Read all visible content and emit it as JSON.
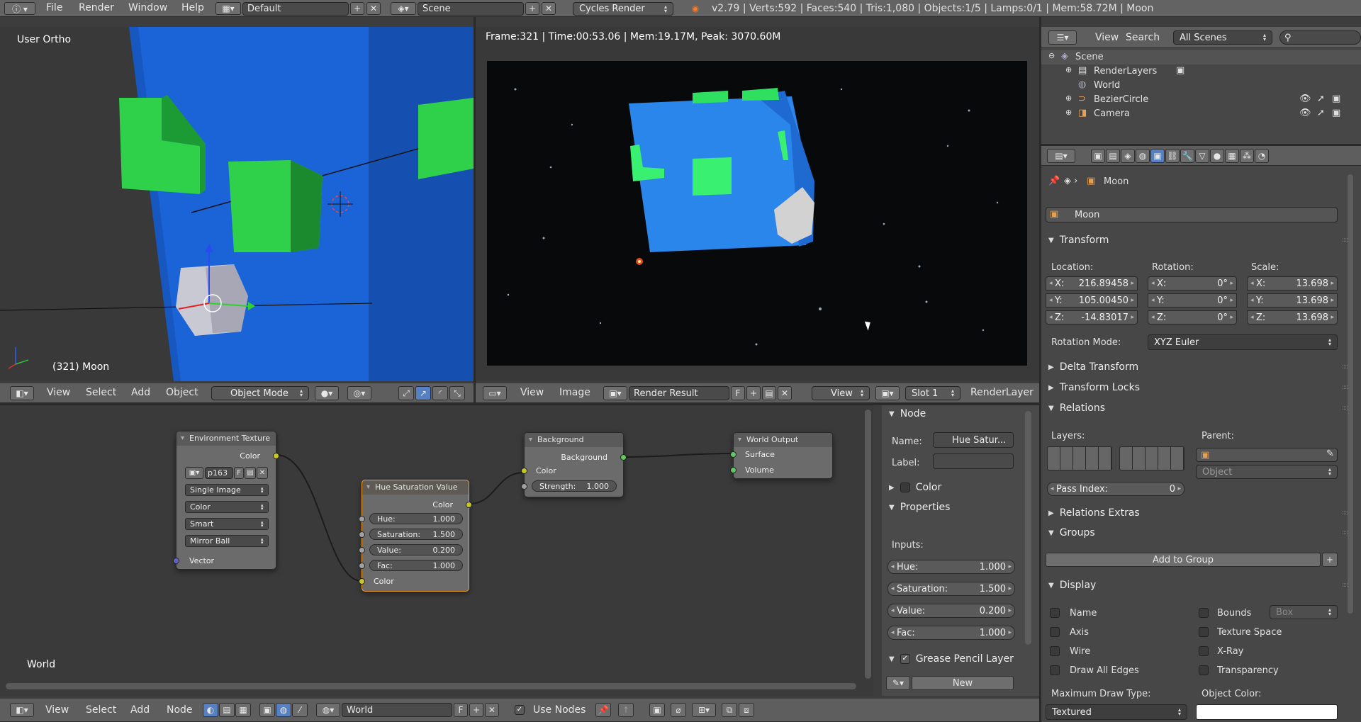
{
  "topbar": {
    "menus": [
      "File",
      "Render",
      "Window",
      "Help"
    ],
    "layout": "Default",
    "scene": "Scene",
    "engine": "Cycles Render",
    "stats": "v2.79 | Verts:592 | Faces:540 | Tris:1,080 | Objects:1/5 | Lamps:0/1 | Mem:58.72M | Moon"
  },
  "viewport3d": {
    "view_label": "User Ortho",
    "object_label": "(321) Moon",
    "menus": [
      "View",
      "Select",
      "Add",
      "Object"
    ],
    "mode": "Object Mode"
  },
  "image_editor": {
    "render_info": "Frame:321 | Time:00:53.06 | Mem:19.17M, Peak: 3070.60M",
    "menus": [
      "View",
      "Image"
    ],
    "image_name": "Render Result",
    "image_flag": "F",
    "view": "View",
    "slot": "Slot 1",
    "layer": "RenderLayer"
  },
  "node_editor": {
    "world_label": "World",
    "menus": [
      "View",
      "Select",
      "Add",
      "Node"
    ],
    "world_name": "World",
    "world_flag": "F",
    "use_nodes": "Use Nodes",
    "nodes": {
      "env": {
        "title": "Environment Texture",
        "out_color": "Color",
        "image": "p163",
        "flag": "F",
        "source": "Single Image",
        "colorspace": "Color",
        "interp": "Smart",
        "projection": "Mirror Ball",
        "vector": "Vector"
      },
      "hsv": {
        "title": "Hue Saturation Value",
        "out_color": "Color",
        "hue_l": "Hue:",
        "hue": "1.000",
        "sat_l": "Saturation:",
        "sat": "1.500",
        "val_l": "Value:",
        "val": "0.200",
        "fac_l": "Fac:",
        "fac": "1.000",
        "in_color": "Color"
      },
      "bg": {
        "title": "Background",
        "out": "Background",
        "color": "Color",
        "strength_l": "Strength:",
        "strength": "1.000"
      },
      "out": {
        "title": "World Output",
        "surface": "Surface",
        "volume": "Volume"
      }
    }
  },
  "node_sidebar": {
    "node_hdr": "Node",
    "name_l": "Name:",
    "name": "Hue Satur...",
    "label_l": "Label:",
    "color_hdr": "Color",
    "props_hdr": "Properties",
    "inputs_l": "Inputs:",
    "hue_l": "Hue:",
    "hue": "1.000",
    "sat_l": "Saturation:",
    "sat": "1.500",
    "val_l": "Value:",
    "val": "0.200",
    "fac_l": "Fac:",
    "fac": "1.000",
    "gp_hdr": "Grease Pencil Layer",
    "new": "New"
  },
  "outliner": {
    "menus": [
      "View",
      "Search"
    ],
    "filter": "All Scenes",
    "items": [
      "Scene",
      "RenderLayers",
      "World",
      "BezierCircle",
      "Camera"
    ]
  },
  "properties": {
    "breadcrumb": "Moon",
    "object_name": "Moon",
    "transform": "Transform",
    "location_l": "Location:",
    "rotation_l": "Rotation:",
    "scale_l": "Scale:",
    "loc": [
      {
        "a": "X:",
        "v": "216.89458"
      },
      {
        "a": "Y:",
        "v": "105.00450"
      },
      {
        "a": "Z:",
        "v": "-14.83017"
      }
    ],
    "rot": [
      {
        "a": "X:",
        "v": "0°"
      },
      {
        "a": "Y:",
        "v": "0°"
      },
      {
        "a": "Z:",
        "v": "0°"
      }
    ],
    "scl": [
      {
        "a": "X:",
        "v": "13.698"
      },
      {
        "a": "Y:",
        "v": "13.698"
      },
      {
        "a": "Z:",
        "v": "13.698"
      }
    ],
    "rot_mode_l": "Rotation Mode:",
    "rot_mode": "XYZ Euler",
    "delta": "Delta Transform",
    "locks": "Transform Locks",
    "relations": "Relations",
    "layers_l": "Layers:",
    "parent_l": "Parent:",
    "parent_type": "Object",
    "pass_l": "Pass Index:",
    "pass": "0",
    "rel_extras": "Relations Extras",
    "groups": "Groups",
    "add_group": "Add to Group",
    "display": "Display",
    "d_name": "Name",
    "d_bounds": "Bounds",
    "d_box": "Box",
    "d_axis": "Axis",
    "d_tex": "Texture Space",
    "d_wire": "Wire",
    "d_xray": "X-Ray",
    "d_edges": "Draw All Edges",
    "d_transp": "Transparency",
    "max_draw_l": "Maximum Draw Type:",
    "obj_color_l": "Object Color:",
    "max_draw": "Textured"
  },
  "colors": {
    "accent": "#5680c2",
    "cube_blue": "#1f6fe0",
    "green": "#22b83a",
    "selected_node": "#f09a2a"
  }
}
